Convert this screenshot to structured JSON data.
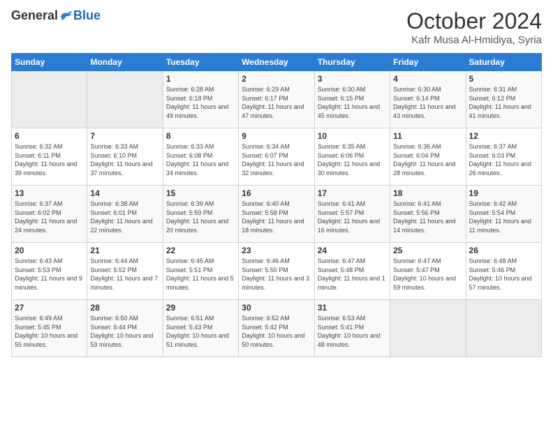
{
  "header": {
    "logo_general": "General",
    "logo_blue": "Blue",
    "month_title": "October 2024",
    "location": "Kafr Musa Al-Hmidiya, Syria"
  },
  "days_of_week": [
    "Sunday",
    "Monday",
    "Tuesday",
    "Wednesday",
    "Thursday",
    "Friday",
    "Saturday"
  ],
  "weeks": [
    [
      {
        "day": "",
        "empty": true
      },
      {
        "day": "",
        "empty": true
      },
      {
        "day": "1",
        "sunrise": "Sunrise: 6:28 AM",
        "sunset": "Sunset: 6:18 PM",
        "daylight": "Daylight: 11 hours and 49 minutes."
      },
      {
        "day": "2",
        "sunrise": "Sunrise: 6:29 AM",
        "sunset": "Sunset: 6:17 PM",
        "daylight": "Daylight: 11 hours and 47 minutes."
      },
      {
        "day": "3",
        "sunrise": "Sunrise: 6:30 AM",
        "sunset": "Sunset: 6:15 PM",
        "daylight": "Daylight: 11 hours and 45 minutes."
      },
      {
        "day": "4",
        "sunrise": "Sunrise: 6:30 AM",
        "sunset": "Sunset: 6:14 PM",
        "daylight": "Daylight: 11 hours and 43 minutes."
      },
      {
        "day": "5",
        "sunrise": "Sunrise: 6:31 AM",
        "sunset": "Sunset: 6:12 PM",
        "daylight": "Daylight: 11 hours and 41 minutes."
      }
    ],
    [
      {
        "day": "6",
        "sunrise": "Sunrise: 6:32 AM",
        "sunset": "Sunset: 6:11 PM",
        "daylight": "Daylight: 11 hours and 39 minutes."
      },
      {
        "day": "7",
        "sunrise": "Sunrise: 6:33 AM",
        "sunset": "Sunset: 6:10 PM",
        "daylight": "Daylight: 11 hours and 37 minutes."
      },
      {
        "day": "8",
        "sunrise": "Sunrise: 6:33 AM",
        "sunset": "Sunset: 6:08 PM",
        "daylight": "Daylight: 11 hours and 34 minutes."
      },
      {
        "day": "9",
        "sunrise": "Sunrise: 6:34 AM",
        "sunset": "Sunset: 6:07 PM",
        "daylight": "Daylight: 11 hours and 32 minutes."
      },
      {
        "day": "10",
        "sunrise": "Sunrise: 6:35 AM",
        "sunset": "Sunset: 6:06 PM",
        "daylight": "Daylight: 11 hours and 30 minutes."
      },
      {
        "day": "11",
        "sunrise": "Sunrise: 6:36 AM",
        "sunset": "Sunset: 6:04 PM",
        "daylight": "Daylight: 11 hours and 28 minutes."
      },
      {
        "day": "12",
        "sunrise": "Sunrise: 6:37 AM",
        "sunset": "Sunset: 6:03 PM",
        "daylight": "Daylight: 11 hours and 26 minutes."
      }
    ],
    [
      {
        "day": "13",
        "sunrise": "Sunrise: 6:37 AM",
        "sunset": "Sunset: 6:02 PM",
        "daylight": "Daylight: 11 hours and 24 minutes."
      },
      {
        "day": "14",
        "sunrise": "Sunrise: 6:38 AM",
        "sunset": "Sunset: 6:01 PM",
        "daylight": "Daylight: 11 hours and 22 minutes."
      },
      {
        "day": "15",
        "sunrise": "Sunrise: 6:39 AM",
        "sunset": "Sunset: 5:59 PM",
        "daylight": "Daylight: 11 hours and 20 minutes."
      },
      {
        "day": "16",
        "sunrise": "Sunrise: 6:40 AM",
        "sunset": "Sunset: 5:58 PM",
        "daylight": "Daylight: 11 hours and 18 minutes."
      },
      {
        "day": "17",
        "sunrise": "Sunrise: 6:41 AM",
        "sunset": "Sunset: 5:57 PM",
        "daylight": "Daylight: 11 hours and 16 minutes."
      },
      {
        "day": "18",
        "sunrise": "Sunrise: 6:41 AM",
        "sunset": "Sunset: 5:56 PM",
        "daylight": "Daylight: 11 hours and 14 minutes."
      },
      {
        "day": "19",
        "sunrise": "Sunrise: 6:42 AM",
        "sunset": "Sunset: 5:54 PM",
        "daylight": "Daylight: 11 hours and 11 minutes."
      }
    ],
    [
      {
        "day": "20",
        "sunrise": "Sunrise: 6:43 AM",
        "sunset": "Sunset: 5:53 PM",
        "daylight": "Daylight: 11 hours and 9 minutes."
      },
      {
        "day": "21",
        "sunrise": "Sunrise: 6:44 AM",
        "sunset": "Sunset: 5:52 PM",
        "daylight": "Daylight: 11 hours and 7 minutes."
      },
      {
        "day": "22",
        "sunrise": "Sunrise: 6:45 AM",
        "sunset": "Sunset: 5:51 PM",
        "daylight": "Daylight: 11 hours and 5 minutes."
      },
      {
        "day": "23",
        "sunrise": "Sunrise: 6:46 AM",
        "sunset": "Sunset: 5:50 PM",
        "daylight": "Daylight: 11 hours and 3 minutes."
      },
      {
        "day": "24",
        "sunrise": "Sunrise: 6:47 AM",
        "sunset": "Sunset: 5:48 PM",
        "daylight": "Daylight: 11 hours and 1 minute."
      },
      {
        "day": "25",
        "sunrise": "Sunrise: 6:47 AM",
        "sunset": "Sunset: 5:47 PM",
        "daylight": "Daylight: 10 hours and 59 minutes."
      },
      {
        "day": "26",
        "sunrise": "Sunrise: 6:48 AM",
        "sunset": "Sunset: 5:46 PM",
        "daylight": "Daylight: 10 hours and 57 minutes."
      }
    ],
    [
      {
        "day": "27",
        "sunrise": "Sunrise: 6:49 AM",
        "sunset": "Sunset: 5:45 PM",
        "daylight": "Daylight: 10 hours and 55 minutes."
      },
      {
        "day": "28",
        "sunrise": "Sunrise: 6:50 AM",
        "sunset": "Sunset: 5:44 PM",
        "daylight": "Daylight: 10 hours and 53 minutes."
      },
      {
        "day": "29",
        "sunrise": "Sunrise: 6:51 AM",
        "sunset": "Sunset: 5:43 PM",
        "daylight": "Daylight: 10 hours and 51 minutes."
      },
      {
        "day": "30",
        "sunrise": "Sunrise: 6:52 AM",
        "sunset": "Sunset: 5:42 PM",
        "daylight": "Daylight: 10 hours and 50 minutes."
      },
      {
        "day": "31",
        "sunrise": "Sunrise: 6:53 AM",
        "sunset": "Sunset: 5:41 PM",
        "daylight": "Daylight: 10 hours and 48 minutes."
      },
      {
        "day": "",
        "empty": true
      },
      {
        "day": "",
        "empty": true
      }
    ]
  ]
}
